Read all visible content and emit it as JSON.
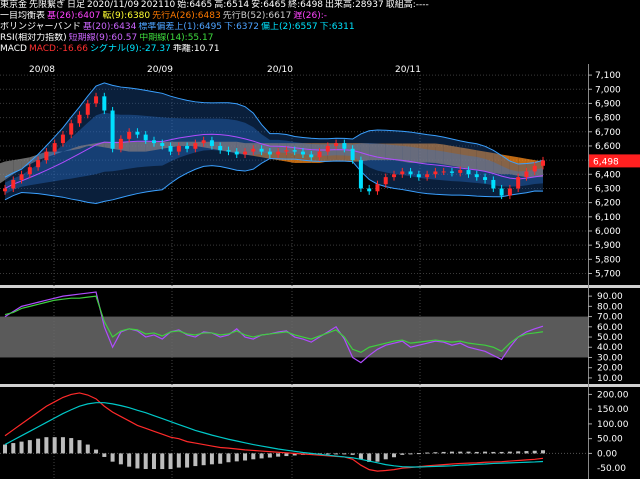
{
  "header": {
    "line1": {
      "market": "東京金",
      "contract": "先限繋ぎ",
      "period": "日足",
      "date": "2020/11/09",
      "month": "202110",
      "open": "始:6465",
      "high": "高:6514",
      "low": "安:6465",
      "close": "終:6498",
      "volume": "出来高:28937",
      "oi": "取組高:----"
    },
    "line2": {
      "name": "一目均衡表",
      "base": "基(26):6407",
      "conv": "転(9):6380",
      "spanA": "先行A(26):6483",
      "spanB": "先行B(52):6617",
      "lag": "遅(26):-"
    },
    "line3": {
      "name": "ボリンジャーバンド",
      "mid": "基(20):6434",
      "up1": "標準偏差上(1):6495",
      "dn1": "下:6372",
      "up2": "偏上(2):6557",
      "dn2": "下:6311"
    },
    "line4": {
      "name": "RSI(相対力指数)",
      "short": "短期線(9):60.57",
      "mid": "中期線(14):55.17"
    },
    "line5": {
      "name": "MACD",
      "macd": "MACD:-16.66",
      "signal": "シグナル(9):-27.37",
      "diff": "乖離:10.71"
    }
  },
  "price_badge": "6,498",
  "colors": {
    "up": "#ff2a2a",
    "down": "#00e0ff",
    "kumoA": "#ff8c1a",
    "kumoB": "#8a8a8a",
    "boll": "#1e5aa8",
    "rsi_short": "#b04cff",
    "rsi_mid": "#3fcf3f",
    "macd": "#ff2a2a",
    "signal": "#00c8c8"
  },
  "chart_data": [
    {
      "type": "line",
      "title": "price",
      "x_tick_labels": [
        "20/08",
        "20/09",
        "20/10",
        "20/11"
      ],
      "y_ticks": [
        5700,
        5800,
        5900,
        6000,
        6100,
        6200,
        6300,
        6400,
        6500,
        6600,
        6700,
        6800,
        6900,
        7000,
        7100
      ],
      "y_tick_labels": [
        "5,700",
        "5,800",
        "5,900",
        "6,000",
        "6,100",
        "6,200",
        "6,300",
        "6,400",
        "6,500",
        "6,600",
        "6,700",
        "6,800",
        "6,900",
        "7,000",
        "7,100"
      ],
      "ylim": [
        5640,
        7150
      ],
      "close": [
        6300,
        6360,
        6400,
        6450,
        6500,
        6560,
        6620,
        6680,
        6760,
        6820,
        6900,
        6950,
        6850,
        6580,
        6650,
        6700,
        6680,
        6640,
        6620,
        6600,
        6560,
        6600,
        6580,
        6620,
        6640,
        6600,
        6570,
        6560,
        6540,
        6560,
        6580,
        6560,
        6540,
        6560,
        6570,
        6560,
        6540,
        6520,
        6560,
        6600,
        6620,
        6580,
        6500,
        6300,
        6280,
        6330,
        6380,
        6400,
        6420,
        6400,
        6380,
        6400,
        6420,
        6420,
        6410,
        6430,
        6400,
        6380,
        6360,
        6300,
        6250,
        6300,
        6380,
        6420,
        6460,
        6498
      ],
      "kumo_span_a": [
        6050,
        6060,
        6080,
        6100,
        6120,
        6150,
        6180,
        6220,
        6260,
        6300,
        6350,
        6400,
        6440,
        6470,
        6490,
        6500,
        6510,
        6520,
        6540,
        6560,
        6560,
        6560,
        6570,
        6580,
        6600,
        6600,
        6590,
        6580,
        6570,
        6560,
        6560,
        6560,
        6570,
        6580,
        6590,
        6600,
        6600,
        6600,
        6590,
        6580,
        6570,
        6560,
        6550,
        6540,
        6530,
        6520,
        6510,
        6500,
        6490,
        6480,
        6480,
        6480,
        6480,
        6490,
        6490,
        6490,
        6490,
        6490,
        6500,
        6500,
        6500,
        6500,
        6490,
        6480,
        6480,
        6483,
        6480,
        6470,
        6460,
        6450,
        6440,
        6430,
        6420,
        6410,
        6400,
        6400,
        6390,
        6380,
        6380,
        6380
      ],
      "kumo_span_b": [
        5900,
        5920,
        5940,
        5960,
        5990,
        6020,
        6060,
        6100,
        6140,
        6180,
        6220,
        6250,
        6280,
        6320,
        6360,
        6400,
        6440,
        6470,
        6500,
        6520,
        6540,
        6560,
        6580,
        6600,
        6610,
        6620,
        6630,
        6630,
        6630,
        6630,
        6630,
        6630,
        6630,
        6630,
        6630,
        6630,
        6630,
        6630,
        6630,
        6630,
        6630,
        6630,
        6630,
        6620,
        6620,
        6620,
        6620,
        6620,
        6620,
        6620,
        6620,
        6620,
        6620,
        6620,
        6620,
        6620,
        6620,
        6620,
        6617,
        6617,
        6617,
        6617,
        6617,
        6617,
        6617,
        6617,
        6617,
        6610,
        6600,
        6590,
        6580,
        6570,
        6560,
        6550,
        6540,
        6530,
        6520,
        6510,
        6500,
        6490
      ],
      "last": 6498
    },
    {
      "type": "line",
      "title": "RSI",
      "y_ticks": [
        10,
        20,
        30,
        40,
        50,
        60,
        70,
        80,
        90
      ],
      "y_tick_labels": [
        "10.00",
        "20.00",
        "30.00",
        "40.00",
        "50.00",
        "60.00",
        "70.00",
        "80.00",
        "90.00"
      ],
      "ylim": [
        6,
        96
      ],
      "series": [
        {
          "name": "短期線(9)",
          "values": [
            70,
            75,
            80,
            82,
            84,
            86,
            88,
            90,
            91,
            92,
            93,
            94,
            60,
            40,
            55,
            58,
            56,
            50,
            52,
            48,
            55,
            57,
            52,
            50,
            55,
            54,
            50,
            52,
            58,
            50,
            48,
            52,
            53,
            55,
            56,
            50,
            48,
            45,
            50,
            55,
            60,
            48,
            30,
            25,
            32,
            38,
            42,
            44,
            46,
            40,
            42,
            44,
            46,
            45,
            42,
            44,
            40,
            38,
            36,
            32,
            28,
            40,
            50,
            55,
            58,
            60.57
          ]
        },
        {
          "name": "中期線(14)",
          "values": [
            72,
            74,
            78,
            80,
            82,
            84,
            86,
            87,
            88,
            88,
            89,
            90,
            65,
            50,
            56,
            58,
            57,
            53,
            54,
            51,
            55,
            56,
            53,
            52,
            54,
            54,
            52,
            53,
            56,
            52,
            50,
            52,
            53,
            54,
            55,
            52,
            50,
            48,
            51,
            54,
            57,
            50,
            38,
            35,
            40,
            42,
            44,
            46,
            47,
            44,
            45,
            46,
            47,
            46,
            45,
            46,
            44,
            43,
            42,
            40,
            36,
            44,
            50,
            53,
            54,
            55.17
          ]
        }
      ]
    },
    {
      "type": "bar",
      "title": "MACD",
      "y_ticks": [
        0,
        50,
        100,
        150,
        200
      ],
      "y_tick_labels": [
        "0.00",
        "50.00",
        "100.00",
        "150.00",
        "200.00"
      ],
      "ylim": [
        -80,
        215
      ],
      "series": [
        {
          "name": "MACD",
          "values": [
            60,
            80,
            100,
            120,
            140,
            160,
            175,
            190,
            200,
            205,
            198,
            185,
            160,
            140,
            125,
            110,
            95,
            85,
            75,
            65,
            55,
            50,
            40,
            35,
            30,
            25,
            20,
            18,
            15,
            12,
            10,
            8,
            6,
            4,
            2,
            0,
            -2,
            -4,
            -6,
            -8,
            -10,
            -12,
            -20,
            -40,
            -55,
            -60,
            -58,
            -55,
            -50,
            -48,
            -45,
            -42,
            -40,
            -38,
            -36,
            -34,
            -33,
            -32,
            -30,
            -29,
            -28,
            -26,
            -24,
            -22,
            -20,
            -16.66
          ]
        },
        {
          "name": "シグナル(9)",
          "values": [
            30,
            45,
            60,
            75,
            90,
            105,
            120,
            135,
            148,
            160,
            168,
            172,
            172,
            168,
            162,
            155,
            146,
            138,
            128,
            118,
            108,
            98,
            88,
            78,
            70,
            62,
            55,
            48,
            42,
            36,
            30,
            25,
            20,
            15,
            11,
            7,
            3,
            0,
            -3,
            -6,
            -9,
            -12,
            -15,
            -20,
            -26,
            -32,
            -38,
            -42,
            -45,
            -46,
            -46,
            -45,
            -44,
            -43,
            -42,
            -40,
            -39,
            -37,
            -36,
            -34,
            -33,
            -32,
            -31,
            -30,
            -29,
            -27.37
          ]
        },
        {
          "name": "乖離",
          "values": [
            30,
            35,
            40,
            45,
            50,
            55,
            55,
            55,
            52,
            45,
            30,
            13,
            -12,
            -28,
            -37,
            -45,
            -51,
            -53,
            -53,
            -53,
            -53,
            -48,
            -48,
            -43,
            -40,
            -37,
            -35,
            -30,
            -27,
            -24,
            -20,
            -17,
            -14,
            -11,
            -9,
            -7,
            -5,
            -4,
            -3,
            -2,
            -1,
            0,
            -5,
            -20,
            -29,
            -28,
            -20,
            -13,
            -5,
            -2,
            1,
            3,
            4,
            5,
            6,
            6,
            6,
            5,
            6,
            5,
            5,
            6,
            7,
            8,
            9,
            10.71
          ]
        }
      ]
    }
  ]
}
